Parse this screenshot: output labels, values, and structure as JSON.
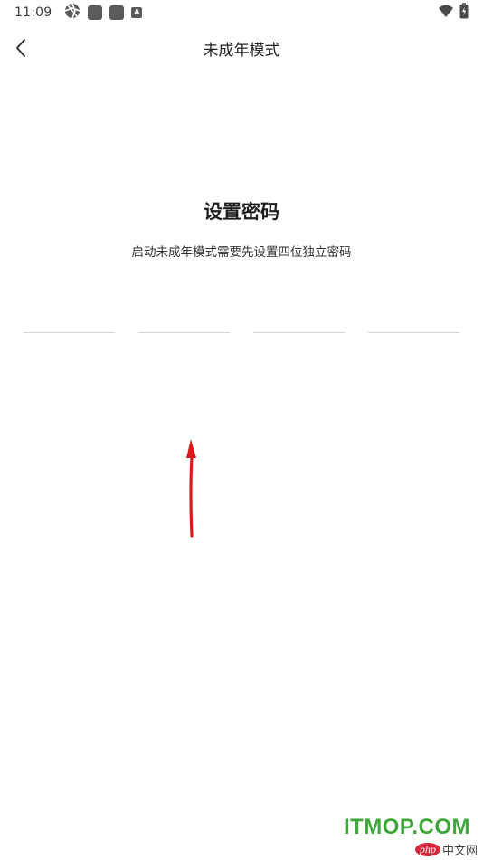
{
  "status_bar": {
    "time": "11:09",
    "icons": [
      "aperture-icon",
      "app-square-icon",
      "app-square-icon",
      "a-box-icon"
    ],
    "a_box_letter": "A",
    "right_icons": [
      "wifi-icon",
      "battery-charging-icon"
    ]
  },
  "nav": {
    "back_icon": "chevron-left-icon",
    "title": "未成年模式"
  },
  "content": {
    "heading": "设置密码",
    "subtext": "启动未成年模式需要先设置四位独立密码",
    "pin_slots": [
      "",
      "",
      "",
      ""
    ]
  },
  "annotation": {
    "arrow_color": "#d91c1c"
  },
  "watermark": {
    "main": "ITMOP.COM",
    "php": "php",
    "sub": "中文网",
    "color": "#3fa63c"
  }
}
